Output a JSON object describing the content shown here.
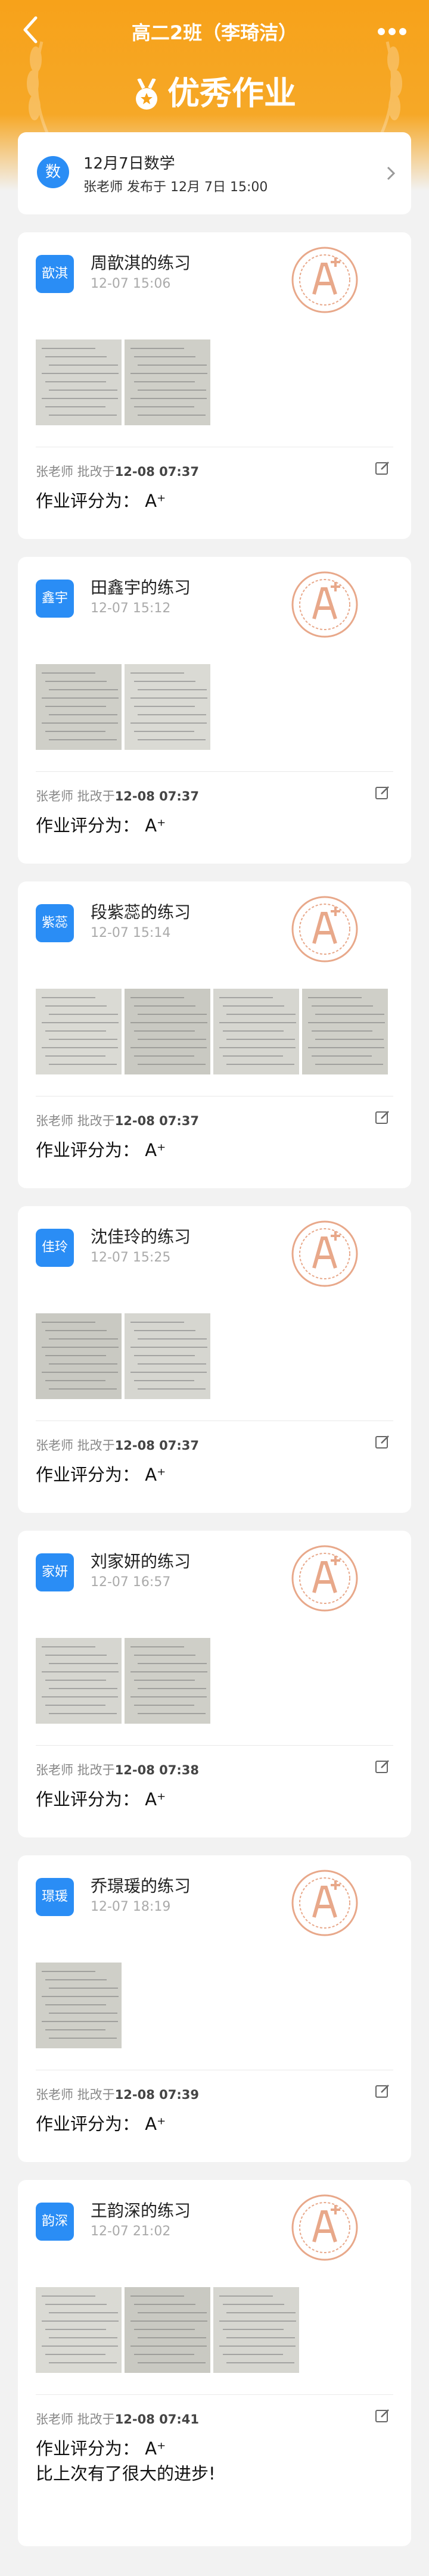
{
  "topbar": {
    "title": "高二2班（李琦洁）"
  },
  "banner": {
    "title": "优秀作业"
  },
  "info": {
    "badge": "数",
    "line1": "12月7日数学",
    "line2": "张老师 发布于 12月 7日 15:00"
  },
  "items": [
    {
      "avatar": "歆淇",
      "name": "周歆淇的练习",
      "time": "12-07 15:06",
      "images": 2,
      "graded_prefix": "张老师 批改于",
      "graded_at": "12-08 07:37",
      "score": "作业评分为：  A⁺",
      "comment": ""
    },
    {
      "avatar": "鑫宇",
      "name": "田鑫宇的练习",
      "time": "12-07 15:12",
      "images": 2,
      "graded_prefix": "张老师 批改于",
      "graded_at": "12-08 07:37",
      "score": "作业评分为：  A⁺",
      "comment": ""
    },
    {
      "avatar": "紫蕊",
      "name": "段紫蕊的练习",
      "time": "12-07 15:14",
      "images": 4,
      "graded_prefix": "张老师 批改于",
      "graded_at": "12-08 07:37",
      "score": "作业评分为：  A⁺",
      "comment": ""
    },
    {
      "avatar": "佳玲",
      "name": "沈佳玲的练习",
      "time": "12-07 15:25",
      "images": 2,
      "graded_prefix": "张老师 批改于",
      "graded_at": "12-08 07:37",
      "score": "作业评分为：  A⁺",
      "comment": ""
    },
    {
      "avatar": "家妍",
      "name": "刘家妍的练习",
      "time": "12-07 16:57",
      "images": 2,
      "graded_prefix": "张老师 批改于",
      "graded_at": "12-08 07:38",
      "score": "作业评分为：  A⁺",
      "comment": ""
    },
    {
      "avatar": "璟瑗",
      "name": "乔璟瑗的练习",
      "time": "12-07 18:19",
      "images": 1,
      "graded_prefix": "张老师 批改于",
      "graded_at": "12-08 07:39",
      "score": "作业评分为：  A⁺",
      "comment": ""
    },
    {
      "avatar": "韵深",
      "name": "王韵深的练习",
      "time": "12-07 21:02",
      "images": 3,
      "graded_prefix": "张老师 批改于",
      "graded_at": "12-08 07:41",
      "score": "作业评分为：  A⁺",
      "comment": "比上次有了很大的进步!"
    }
  ],
  "colors": {
    "accent": "#f7a21a",
    "avatar": "#2a8df5",
    "stamp": "#e8a88a"
  },
  "icons": {
    "back": "chevron-left-icon",
    "more": "more-dots-icon",
    "medal": "medal-icon",
    "edit": "edit-icon",
    "stamp": "excellent-stamp-icon"
  }
}
